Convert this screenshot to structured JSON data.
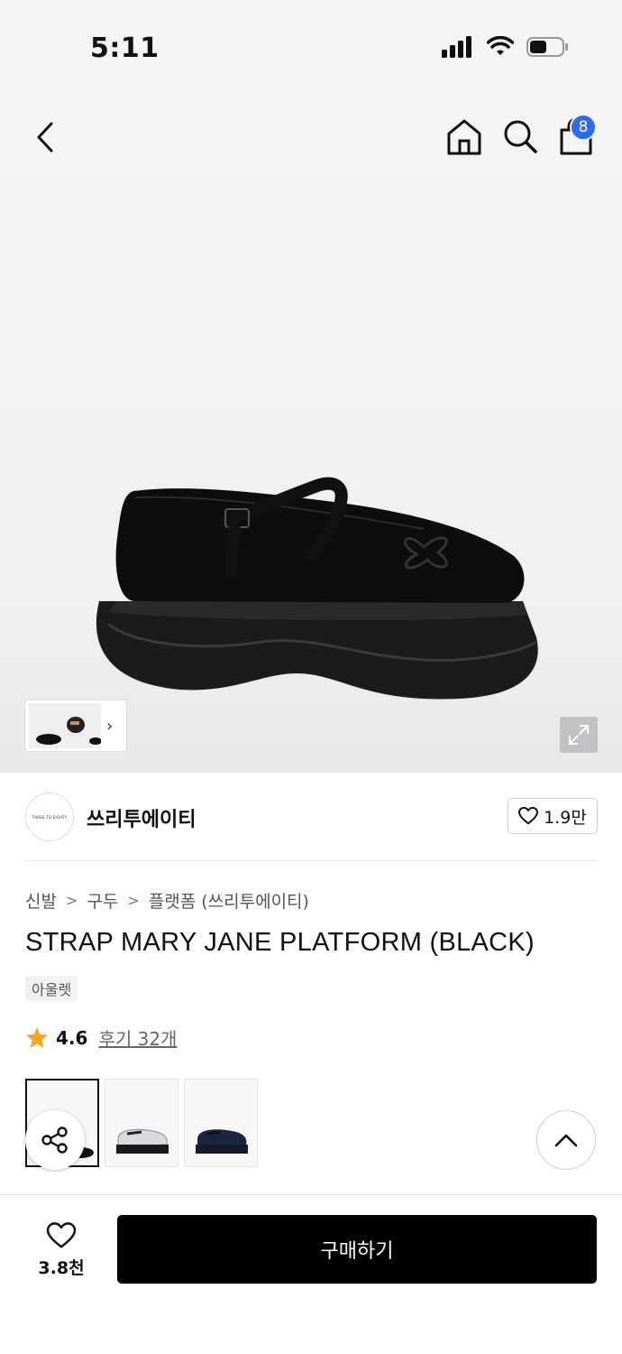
{
  "status_bar": {
    "time": "5:11"
  },
  "header": {
    "cart_count": "8"
  },
  "icons": {
    "back": "chevron-left-icon",
    "home": "home-icon",
    "search": "search-icon",
    "cart": "shopping-bag-icon",
    "expand": "expand-icon",
    "heart": "heart-icon",
    "star": "star-icon",
    "share": "share-icon",
    "scroll_top": "chevron-up-icon"
  },
  "brand": {
    "logo_text": "THREE TO EIGHTY",
    "name": "쓰리투에이티",
    "like_count": "1.9만"
  },
  "breadcrumb": [
    "신발",
    "구두",
    "플랫폼 (쓰리투에이티)"
  ],
  "product": {
    "title": "STRAP MARY JANE PLATFORM (BLACK)",
    "tag": "아울렛",
    "rating": "4.6",
    "review_link": "후기 32개"
  },
  "bottom_bar": {
    "wish_count": "3.8천",
    "buy_label": "구매하기"
  },
  "colors": {
    "accent_badge": "#2b6cf0",
    "buy_button": "#000000",
    "star": "#f5a623"
  }
}
